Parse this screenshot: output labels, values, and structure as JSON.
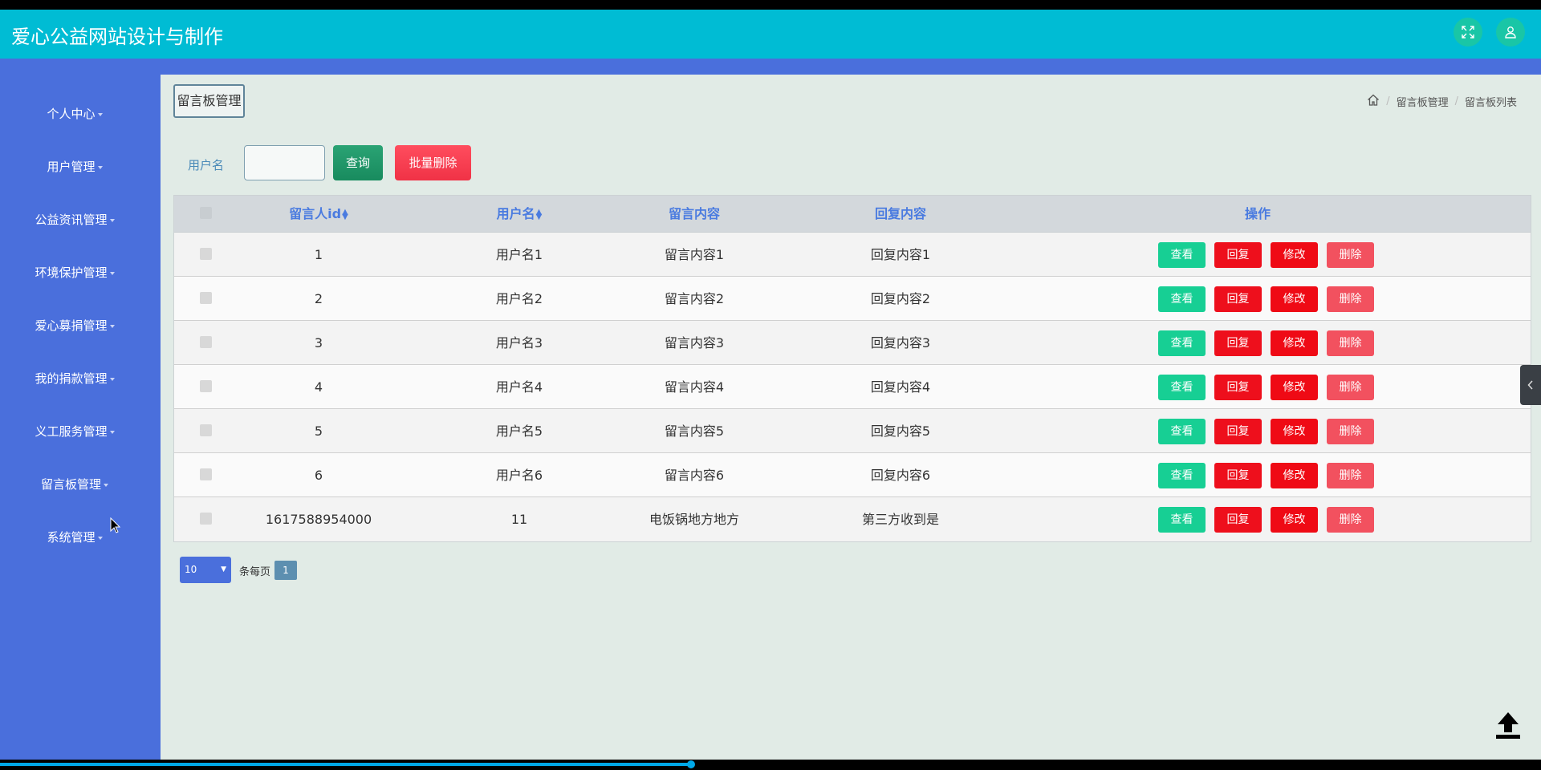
{
  "app": {
    "title": "爱心公益网站设计与制作"
  },
  "header": {
    "icons": [
      "fullscreen-icon",
      "user-icon"
    ],
    "colors": {
      "topbar": "#00bcd4",
      "accent": "#4a6fdc"
    }
  },
  "sidebar": {
    "items": [
      {
        "label": "个人中心"
      },
      {
        "label": "用户管理"
      },
      {
        "label": "公益资讯管理"
      },
      {
        "label": "环境保护管理"
      },
      {
        "label": "爱心募捐管理"
      },
      {
        "label": "我的捐款管理"
      },
      {
        "label": "义工服务管理"
      },
      {
        "label": "留言板管理"
      },
      {
        "label": "系统管理"
      }
    ]
  },
  "page": {
    "title": "留言板管理",
    "breadcrumb": [
      "留言板管理",
      "留言板列表"
    ]
  },
  "search": {
    "label": "用户名",
    "value": "",
    "query_label": "查询",
    "batch_delete_label": "批量删除"
  },
  "table": {
    "headers": {
      "id": "留言人id",
      "username": "用户名",
      "content": "留言内容",
      "reply": "回复内容",
      "actions": "操作"
    },
    "action_labels": {
      "view": "查看",
      "reply": "回复",
      "edit": "修改",
      "delete": "删除"
    },
    "rows": [
      {
        "id": "1",
        "username": "用户名1",
        "content": "留言内容1",
        "reply": "回复内容1"
      },
      {
        "id": "2",
        "username": "用户名2",
        "content": "留言内容2",
        "reply": "回复内容2"
      },
      {
        "id": "3",
        "username": "用户名3",
        "content": "留言内容3",
        "reply": "回复内容3"
      },
      {
        "id": "4",
        "username": "用户名4",
        "content": "留言内容4",
        "reply": "回复内容4"
      },
      {
        "id": "5",
        "username": "用户名5",
        "content": "留言内容5",
        "reply": "回复内容5"
      },
      {
        "id": "6",
        "username": "用户名6",
        "content": "留言内容6",
        "reply": "回复内容6"
      },
      {
        "id": "1617588954000",
        "username": "11",
        "content": "电饭锅地方地方",
        "reply": "第三方收到是"
      }
    ]
  },
  "pagination": {
    "page_size": "10",
    "per_page_label": "条每页",
    "current_page": "1"
  }
}
